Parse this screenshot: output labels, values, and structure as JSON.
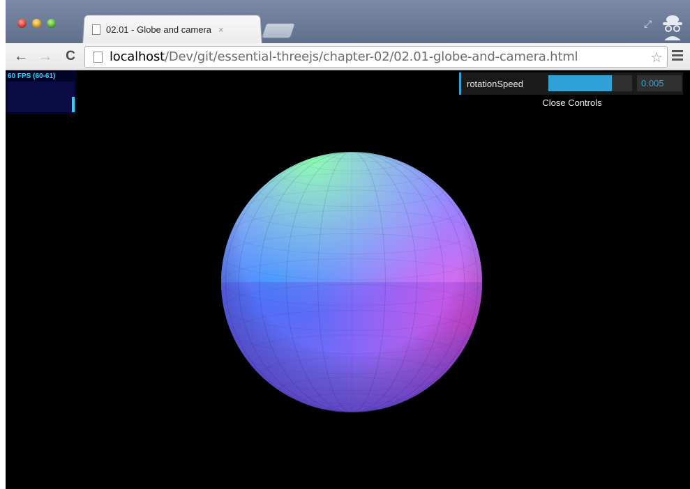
{
  "browser": {
    "tab": {
      "title": "02.01 - Globe and camera",
      "close_symbol": "×"
    },
    "toolbar": {
      "back_icon": "arrow-left-icon",
      "forward_icon": "arrow-right-icon",
      "reload_icon": "reload-icon",
      "url_host": "localhost",
      "url_path": "/Dev/git/essential-threejs/chapter-02/02.01-globe-and-camera.html"
    }
  },
  "stats": {
    "label": "60 FPS (60-61)"
  },
  "gui": {
    "controller_label": "rotationSpeed",
    "controller_value": "0.005",
    "slider_fraction": 0.76,
    "close_label": "Close Controls",
    "accent_color": "#2fa1d6"
  }
}
